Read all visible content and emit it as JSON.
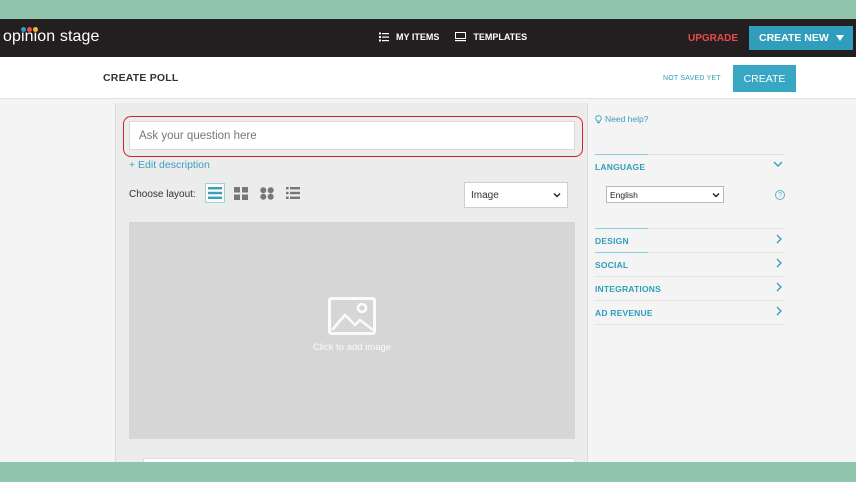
{
  "header": {
    "logo_text": "opinion stage",
    "nav": [
      {
        "label": "MY ITEMS",
        "icon": "list-icon"
      },
      {
        "label": "TEMPLATES",
        "icon": "templates-icon"
      }
    ],
    "upgrade_label": "UPGRADE",
    "create_new_label": "CREATE NEW"
  },
  "subheader": {
    "title": "CREATE POLL",
    "save_status": "NOT SAVED YET",
    "create_label": "CREATE"
  },
  "editor": {
    "question_placeholder": "Ask your question here",
    "edit_description": "+ Edit description",
    "layout_label": "Choose layout:",
    "layout_options": [
      "list-layout",
      "grid-layout",
      "circles-layout",
      "bullets-layout"
    ],
    "media_type": "Image",
    "image_caption": "Click to add image"
  },
  "settings": {
    "help_label": "Need help?",
    "sections": [
      {
        "label": "LANGUAGE",
        "expanded": true
      },
      {
        "label": "DESIGN",
        "expanded": false
      },
      {
        "label": "SOCIAL",
        "expanded": false
      },
      {
        "label": "INTEGRATIONS",
        "expanded": false
      },
      {
        "label": "AD REVENUE",
        "expanded": false
      }
    ],
    "language": "English"
  },
  "colors": {
    "accent": "#2f9dbb",
    "upgrade": "#ea4a4a",
    "navbar": "#231f20",
    "highlight_outline": "#c62828"
  }
}
